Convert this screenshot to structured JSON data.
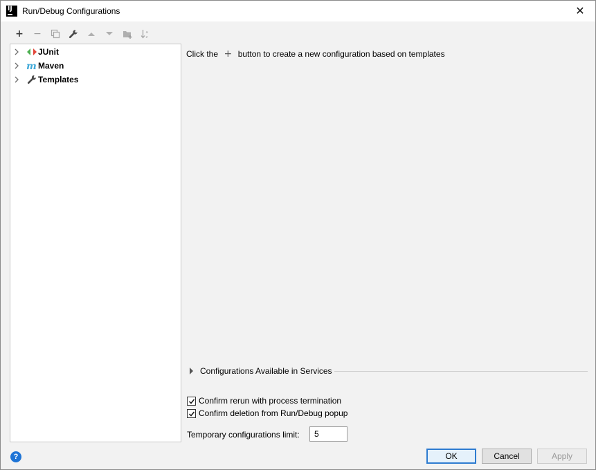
{
  "window": {
    "title": "Run/Debug Configurations",
    "app_icon_letters": "IJ",
    "close_glyph": "✕"
  },
  "toolbar": {
    "buttons": [
      {
        "name": "add-icon",
        "glyph": "+",
        "enabled": true
      },
      {
        "name": "remove-icon",
        "glyph": "−",
        "enabled": false
      },
      {
        "name": "copy-icon",
        "enabled": false
      },
      {
        "name": "wrench-icon",
        "enabled": true
      },
      {
        "name": "move-up-icon",
        "enabled": false
      },
      {
        "name": "move-down-icon",
        "enabled": false
      },
      {
        "name": "new-folder-icon",
        "enabled": false
      },
      {
        "name": "sort-icon",
        "enabled": false
      }
    ]
  },
  "tree": {
    "items": [
      {
        "label": "JUnit",
        "icon": "junit-icon"
      },
      {
        "label": "Maven",
        "icon": "maven-icon"
      },
      {
        "label": "Templates",
        "icon": "wrench-icon"
      }
    ]
  },
  "content": {
    "hint_before": "Click the",
    "hint_plus": "+",
    "hint_after": "button to create a new configuration based on templates",
    "services_label": "Configurations Available in Services",
    "confirm_rerun": {
      "label": "Confirm rerun with process termination",
      "checked": true
    },
    "confirm_deletion": {
      "label": "Confirm deletion from Run/Debug popup",
      "checked": true
    },
    "temp_limit_label": "Temporary configurations limit:",
    "temp_limit_value": "5"
  },
  "footer": {
    "help_glyph": "?",
    "ok_label": "OK",
    "cancel_label": "Cancel",
    "apply_label": "Apply"
  },
  "colors": {
    "accent": "#2d7bd0",
    "help_blue": "#1e74d6",
    "junit_green": "#4caf50",
    "junit_red": "#e2463a",
    "maven_blue": "#40a9d8"
  }
}
